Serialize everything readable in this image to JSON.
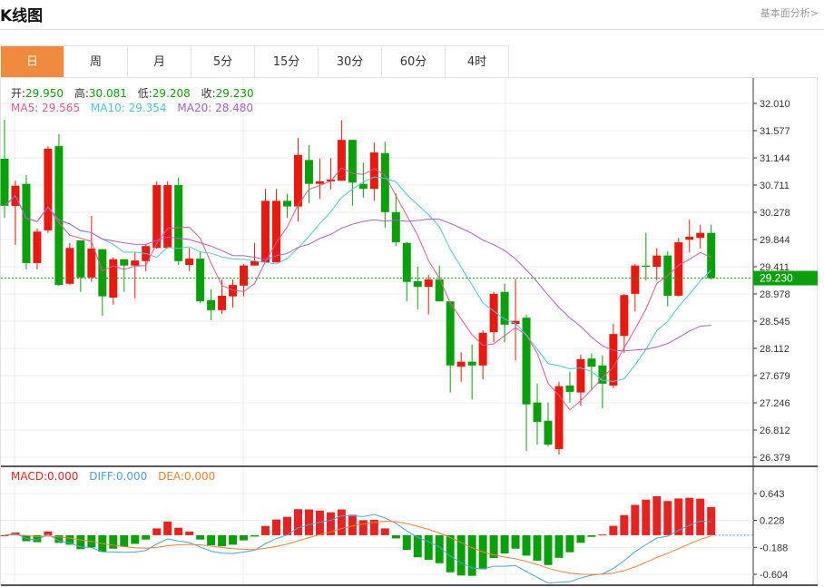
{
  "header": {
    "title": "K线图",
    "more_link": "基本面分析>"
  },
  "tabs": [
    {
      "label": "日",
      "active": true
    },
    {
      "label": "周"
    },
    {
      "label": "月"
    },
    {
      "label": "5分"
    },
    {
      "label": "15分"
    },
    {
      "label": "30分"
    },
    {
      "label": "60分"
    },
    {
      "label": "4时"
    }
  ],
  "ohlc_info": {
    "open_label": "开:",
    "open": "29.950",
    "high_label": "高:",
    "high": "30.081",
    "low_label": "低:",
    "low": "29.208",
    "close_label": "收:",
    "close": "29.230"
  },
  "ma_info": {
    "ma5": "MA5: 29.565",
    "ma10": "MA10: 29.354",
    "ma20": "MA20: 28.480"
  },
  "macd_info": {
    "macd": "MACD:0.000",
    "diff": "DIFF:0.000",
    "dea": "DEA:0.000"
  },
  "colors": {
    "up": "#e8190e",
    "down": "#0aa00a",
    "ma5": "#e8578a",
    "ma10": "#4cc7d6",
    "ma20": "#b05dc7",
    "diff": "#4aa3df",
    "dea": "#f08030",
    "tab_active": "#f08a3c"
  },
  "chart_data": [
    {
      "type": "candlestick",
      "price_ticks": [
        "32.010",
        "31.577",
        "31.144",
        "30.711",
        "30.278",
        "29.844",
        "29.411",
        "28.978",
        "28.545",
        "28.112",
        "27.679",
        "27.246",
        "26.812",
        "26.379"
      ],
      "ylim": [
        26.379,
        32.01
      ],
      "current_price": "29.230",
      "grid": true,
      "ohlc": [
        [
          31.13,
          31.75,
          30.19,
          30.38
        ],
        [
          30.38,
          30.78,
          29.76,
          30.7
        ],
        [
          30.73,
          30.87,
          29.37,
          29.47
        ],
        [
          29.47,
          30.02,
          29.37,
          29.97
        ],
        [
          29.99,
          31.33,
          29.95,
          31.29
        ],
        [
          31.33,
          31.52,
          29.11,
          29.12
        ],
        [
          29.14,
          29.79,
          29.12,
          29.71
        ],
        [
          29.83,
          29.83,
          29.01,
          29.24
        ],
        [
          29.24,
          30.22,
          29.17,
          29.7
        ],
        [
          29.69,
          29.69,
          28.63,
          28.94
        ],
        [
          28.92,
          29.56,
          28.81,
          29.53
        ],
        [
          29.53,
          29.53,
          29.01,
          29.43
        ],
        [
          29.43,
          29.64,
          28.91,
          29.51
        ],
        [
          29.5,
          29.77,
          29.34,
          29.74
        ],
        [
          29.71,
          30.77,
          29.7,
          30.71
        ],
        [
          29.71,
          30.77,
          29.7,
          30.71
        ],
        [
          30.71,
          30.83,
          29.44,
          29.5
        ],
        [
          29.44,
          29.71,
          29.34,
          29.54
        ],
        [
          29.54,
          29.64,
          28.83,
          28.86
        ],
        [
          28.88,
          29.05,
          28.56,
          28.72
        ],
        [
          28.72,
          29.21,
          28.66,
          28.95
        ],
        [
          28.94,
          29.21,
          28.76,
          29.12
        ],
        [
          29.11,
          29.45,
          28.94,
          29.43
        ],
        [
          29.43,
          29.79,
          29.43,
          29.5
        ],
        [
          29.48,
          30.65,
          29.48,
          30.46
        ],
        [
          29.48,
          30.65,
          29.48,
          30.46
        ],
        [
          30.46,
          30.57,
          30.19,
          30.37
        ],
        [
          30.37,
          31.46,
          30.13,
          31.19
        ],
        [
          31.11,
          31.35,
          30.42,
          30.73
        ],
        [
          30.73,
          31.13,
          30.49,
          30.77
        ],
        [
          30.77,
          31.14,
          30.64,
          30.8
        ],
        [
          30.78,
          31.74,
          30.78,
          31.43
        ],
        [
          31.43,
          31.43,
          30.38,
          30.75
        ],
        [
          30.73,
          31.07,
          30.51,
          30.65
        ],
        [
          30.65,
          31.39,
          30.46,
          31.23
        ],
        [
          31.22,
          31.4,
          30.03,
          30.28
        ],
        [
          30.28,
          30.58,
          29.74,
          29.8
        ],
        [
          29.79,
          29.8,
          28.86,
          29.17
        ],
        [
          29.18,
          29.41,
          28.73,
          29.09
        ],
        [
          29.09,
          29.28,
          28.65,
          29.21
        ],
        [
          29.21,
          29.43,
          28.86,
          28.86
        ],
        [
          28.86,
          28.86,
          27.41,
          27.84
        ],
        [
          27.82,
          28.05,
          27.58,
          27.9
        ],
        [
          27.9,
          28.17,
          27.3,
          27.84
        ],
        [
          27.84,
          28.4,
          27.62,
          28.36
        ],
        [
          28.37,
          29.01,
          28.21,
          28.98
        ],
        [
          29.01,
          29.14,
          28.21,
          28.49
        ],
        [
          28.5,
          29.22,
          27.92,
          28.55
        ],
        [
          28.6,
          28.65,
          26.48,
          27.22
        ],
        [
          27.25,
          27.55,
          26.58,
          26.94
        ],
        [
          26.96,
          27.25,
          26.55,
          26.58
        ],
        [
          26.51,
          27.58,
          26.42,
          27.51
        ],
        [
          27.52,
          27.74,
          27.25,
          27.42
        ],
        [
          27.41,
          28.01,
          27.2,
          27.94
        ],
        [
          27.95,
          28.03,
          27.45,
          27.82
        ],
        [
          27.84,
          28.0,
          27.16,
          27.55
        ],
        [
          27.52,
          28.5,
          27.48,
          28.34
        ],
        [
          28.31,
          28.98,
          28.04,
          28.96
        ],
        [
          28.98,
          29.45,
          28.7,
          29.43
        ],
        [
          29.43,
          29.95,
          29.19,
          29.41
        ],
        [
          29.41,
          29.71,
          29.19,
          29.59
        ],
        [
          29.59,
          29.66,
          28.78,
          28.95
        ],
        [
          28.95,
          29.87,
          28.94,
          29.8
        ],
        [
          29.84,
          30.16,
          29.64,
          29.89
        ],
        [
          29.87,
          30.08,
          29.7,
          29.95
        ],
        [
          29.95,
          30.081,
          29.208,
          29.23
        ]
      ]
    },
    {
      "type": "macd",
      "ticks": [
        "0.643",
        "0.228",
        "-0.188",
        "-0.604"
      ],
      "ylim": [
        -0.604,
        0.643
      ]
    }
  ]
}
